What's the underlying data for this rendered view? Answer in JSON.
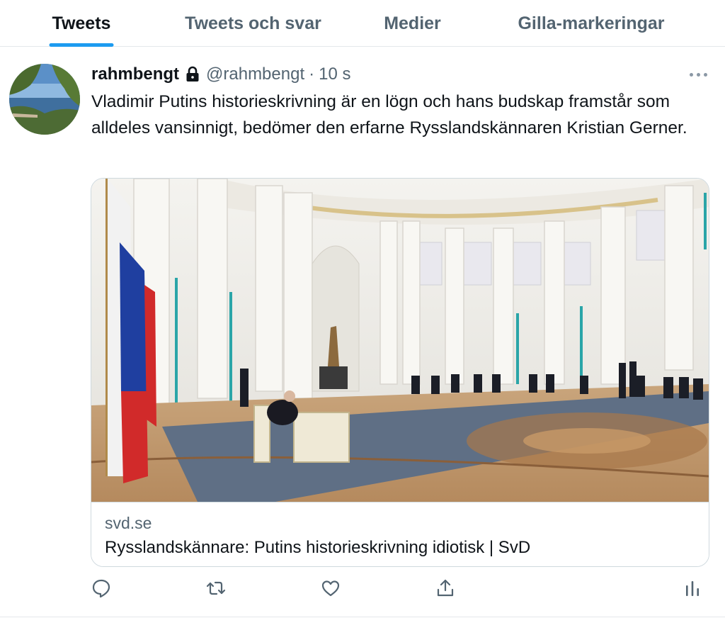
{
  "tabs": [
    {
      "label": "Tweets",
      "active": true
    },
    {
      "label": "Tweets och svar",
      "active": false
    },
    {
      "label": "Medier",
      "active": false
    },
    {
      "label": "Gilla-markeringar",
      "active": false
    }
  ],
  "tweet": {
    "display_name": "rahmbengt",
    "protected_icon": "lock-icon",
    "handle": "@rahmbengt",
    "separator": "·",
    "time": "10 s",
    "text": "Vladimir Putins historieskrivning är en lögn och hans budskap framstår som alldeles vansinnigt, bedömer den erfarne Rysslandskännaren Kristian Gerner.",
    "card": {
      "domain": "svd.se",
      "title": "Rysslandskännare: Putins historieskrivning idiotisk | SvD"
    },
    "actions": [
      "reply-icon",
      "retweet-icon",
      "like-icon",
      "share-icon",
      "analytics-icon"
    ]
  },
  "colors": {
    "accent": "#1d9bf0",
    "secondary_text": "#536471",
    "border": "#cfd9de"
  }
}
